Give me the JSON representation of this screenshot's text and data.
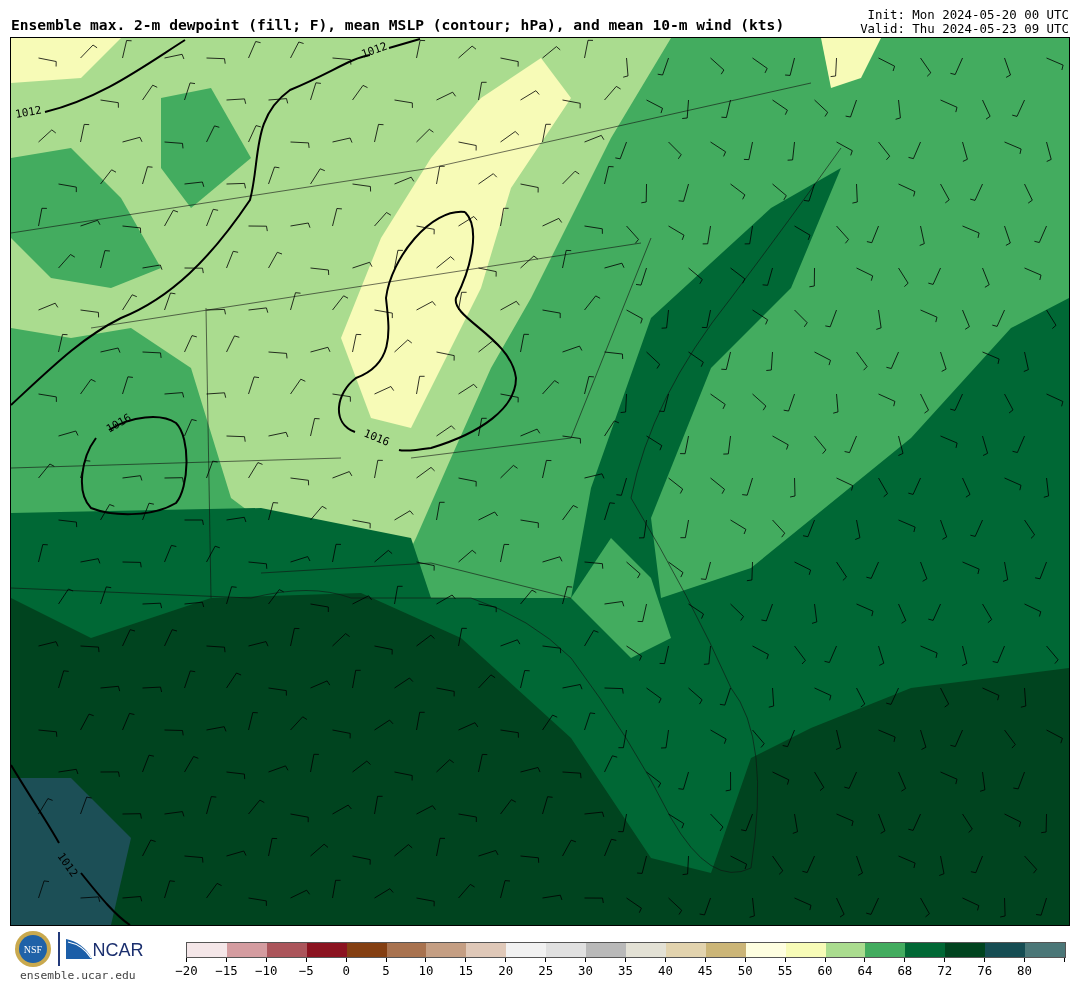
{
  "header": {
    "title": "Ensemble max. 2-m dewpoint (fill; F), mean MSLP (contour; hPa), and mean 10-m wind (kts)",
    "init": "Init: Mon 2024-05-20 00 UTC",
    "valid": "Valid: Thu 2024-05-23 09 UTC"
  },
  "map": {
    "contour_labels": [
      {
        "text": "1012",
        "kind": "topleft"
      },
      {
        "text": "1012",
        "kind": "top"
      },
      {
        "text": "1016",
        "kind": "west"
      },
      {
        "text": "1016",
        "kind": "central"
      },
      {
        "text": "1012",
        "kind": "southwest"
      }
    ]
  },
  "footer": {
    "nsf_logo": "NSF",
    "ncar_logo": "NCAR",
    "site": "ensemble.ucar.edu"
  },
  "color_scale": {
    "bins": [
      {
        "color": "#f4e6e8"
      },
      {
        "color": "#d49ca0"
      },
      {
        "color": "#ab555b"
      },
      {
        "color": "#8b1320"
      },
      {
        "color": "#843f12"
      },
      {
        "color": "#a8724f"
      },
      {
        "color": "#c49e83"
      },
      {
        "color": "#dfc8b8"
      },
      {
        "color": "#f1f1f1"
      },
      {
        "color": "#e0e0e0"
      },
      {
        "color": "#b9b9b9"
      },
      {
        "color": "#e3e1d5"
      },
      {
        "color": "#e2d3ae"
      },
      {
        "color": "#cbb577"
      },
      {
        "color": "#fefee0"
      },
      {
        "color": "#f7fbb7"
      },
      {
        "color": "#aadc8f"
      },
      {
        "color": "#43ac5f"
      },
      {
        "color": "#006835"
      },
      {
        "color": "#00441f"
      },
      {
        "color": "#164d53"
      },
      {
        "color": "#4b7778"
      }
    ],
    "ticks": [
      "−20",
      "−15",
      "−10",
      "−5",
      "0",
      "5",
      "10",
      "15",
      "20",
      "25",
      "30",
      "35",
      "40",
      "45",
      "50",
      "55",
      "60",
      "64",
      "68",
      "72",
      "76",
      "80"
    ]
  }
}
